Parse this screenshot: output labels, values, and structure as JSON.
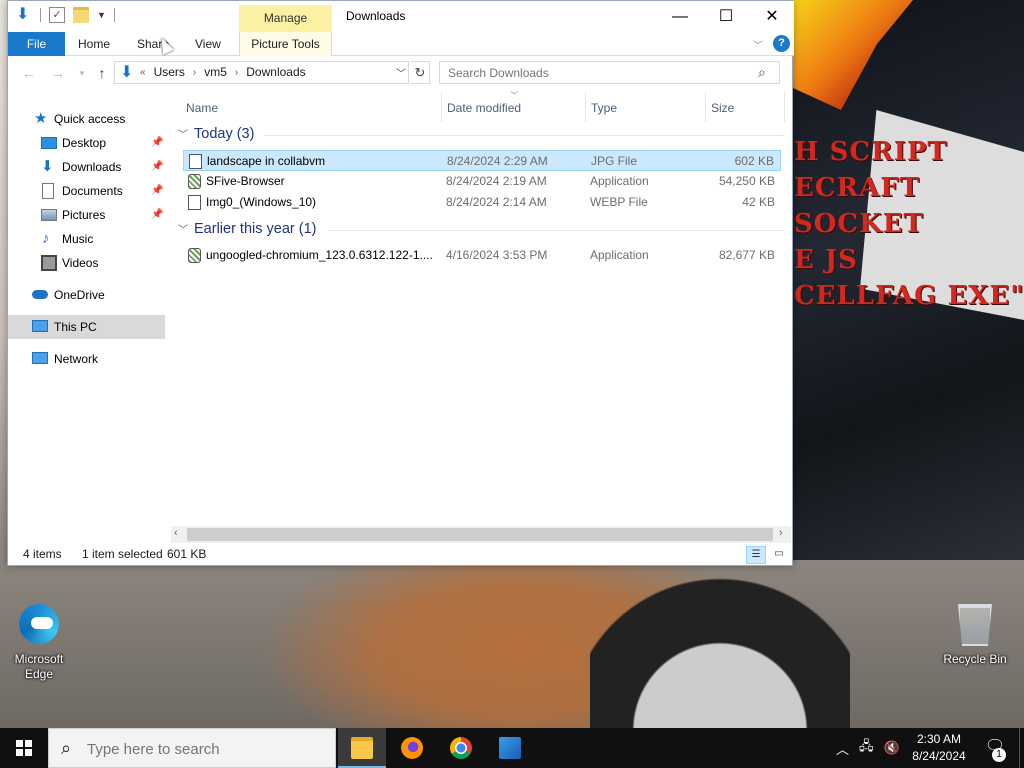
{
  "desktop": {
    "overlay_lines": [
      "H SCRIPT",
      "ECRAFT",
      "SOCKET",
      "E JS",
      "CELLFAG EXE\""
    ],
    "icons": {
      "edge": "Microsoft Edge",
      "recycle_bin": "Recycle Bin"
    }
  },
  "window": {
    "title": "Downloads",
    "contextual_group": "Manage",
    "qat": {
      "icons": [
        "download-arrow-icon",
        "checkbox-icon",
        "folder-icon",
        "dropdown-icon"
      ]
    },
    "controls": {
      "minimize": "—",
      "maximize": "☐",
      "close": "✕"
    }
  },
  "ribbon": {
    "tabs": {
      "file": "File",
      "home": "Home",
      "share": "Share",
      "view": "View",
      "picture_tools": "Picture Tools"
    },
    "help": "?"
  },
  "address": {
    "overflow": "«",
    "crumbs": [
      "Users",
      "vm5",
      "Downloads"
    ],
    "separator": "›"
  },
  "search": {
    "placeholder": "Search Downloads"
  },
  "nav": {
    "quick_access": "Quick access",
    "desktop": "Desktop",
    "downloads": "Downloads",
    "documents": "Documents",
    "pictures": "Pictures",
    "music": "Music",
    "videos": "Videos",
    "onedrive": "OneDrive",
    "this_pc": "This PC",
    "network": "Network"
  },
  "columns": {
    "name": "Name",
    "date": "Date modified",
    "type": "Type",
    "size": "Size"
  },
  "groups": [
    {
      "label": "Today (3)",
      "files": [
        {
          "name": "landscape in collabvm",
          "date": "8/24/2024 2:29 AM",
          "type": "JPG File",
          "size": "602 KB",
          "selected": true
        },
        {
          "name": "SFive-Browser",
          "date": "8/24/2024 2:19 AM",
          "type": "Application",
          "size": "54,250 KB"
        },
        {
          "name": "Img0_(Windows_10)",
          "date": "8/24/2024 2:14 AM",
          "type": "WEBP File",
          "size": "42 KB"
        }
      ]
    },
    {
      "label": "Earlier this year (1)",
      "files": [
        {
          "name": "ungoogled-chromium_123.0.6312.122-1....",
          "date": "4/16/2024 3:53 PM",
          "type": "Application",
          "size": "82,677 KB"
        }
      ]
    }
  ],
  "status": {
    "count": "4 items",
    "selected": "1 item selected",
    "size": "601 KB"
  },
  "taskbar": {
    "search_placeholder": "Type here to search",
    "time": "2:30 AM",
    "date": "8/24/2024",
    "notification_count": "1"
  }
}
